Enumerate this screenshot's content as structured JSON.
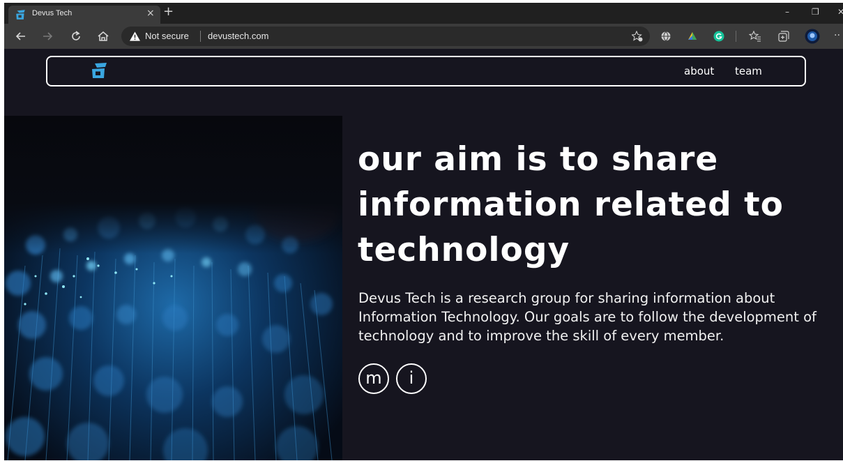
{
  "browser": {
    "tab_title": "Devus Tech",
    "tab_close": "×",
    "new_tab": "+",
    "security_label": "Not secure",
    "url": "devustech.com",
    "icons": [
      "back-icon",
      "forward-icon",
      "reload-icon",
      "home-icon",
      "warning-icon",
      "add-favorite-icon",
      "extension-globe-icon",
      "extension-color-icon",
      "grammarly-icon",
      "favorites-icon",
      "collections-icon",
      "profile-avatar-icon",
      "more-icon"
    ],
    "window_controls": {
      "minimize": "–",
      "restore": "❐",
      "close": "✕"
    }
  },
  "site": {
    "nav": {
      "links": [
        {
          "label": "about"
        },
        {
          "label": "team"
        }
      ]
    },
    "hero": {
      "headline": "our aim is to share information related to technology",
      "description": "Devus Tech is a research group for sharing information about Information Technology. Our goals are to follow the development of technology and to improve the skill of every member.",
      "social": [
        {
          "glyph": "m"
        },
        {
          "glyph": "i"
        }
      ]
    }
  },
  "colors": {
    "page_background": "#16151f",
    "brand_accent": "#3aa6e0",
    "text": "#ffffff"
  }
}
